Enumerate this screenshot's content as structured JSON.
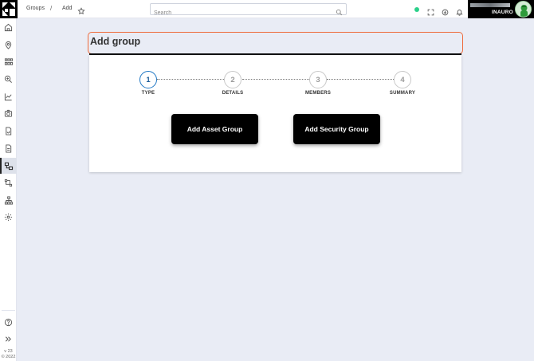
{
  "header": {
    "breadcrumb": [
      "Groups",
      "Add"
    ],
    "breadcrumb_separator": "/",
    "search_placeholder": "Search",
    "organization": "INAURO",
    "status_color": "#2bd08a",
    "icons": [
      "star-icon",
      "search-icon",
      "fullscreen-icon",
      "download-icon",
      "bell-icon"
    ]
  },
  "sidebar": {
    "items": [
      {
        "icon": "home-icon"
      },
      {
        "icon": "location-pin-icon"
      },
      {
        "icon": "grid-devices-icon"
      },
      {
        "icon": "zoom-search-icon"
      },
      {
        "icon": "line-chart-icon"
      },
      {
        "icon": "camera-icon"
      },
      {
        "icon": "document-refresh-icon"
      },
      {
        "icon": "document-icon"
      },
      {
        "icon": "groups-icon",
        "active": true
      },
      {
        "icon": "workflow-icon"
      },
      {
        "icon": "hierarchy-icon"
      },
      {
        "icon": "settings-icon"
      }
    ],
    "bottom": [
      {
        "icon": "help-icon"
      },
      {
        "icon": "expand-icon"
      }
    ],
    "version_line1": "v 23",
    "version_line2": "© 2022"
  },
  "page": {
    "title": "Add group",
    "steps": [
      {
        "number": "1",
        "label": "TYPE",
        "active": true
      },
      {
        "number": "2",
        "label": "DETAILS",
        "active": false
      },
      {
        "number": "3",
        "label": "MEMBERS",
        "active": false
      },
      {
        "number": "4",
        "label": "SUMMARY",
        "active": false
      }
    ],
    "actions": {
      "add_asset_group": "Add Asset Group",
      "add_security_group": "Add Security Group"
    },
    "accent_color": "#ee6a3a",
    "active_step_color": "#1f77c4"
  }
}
